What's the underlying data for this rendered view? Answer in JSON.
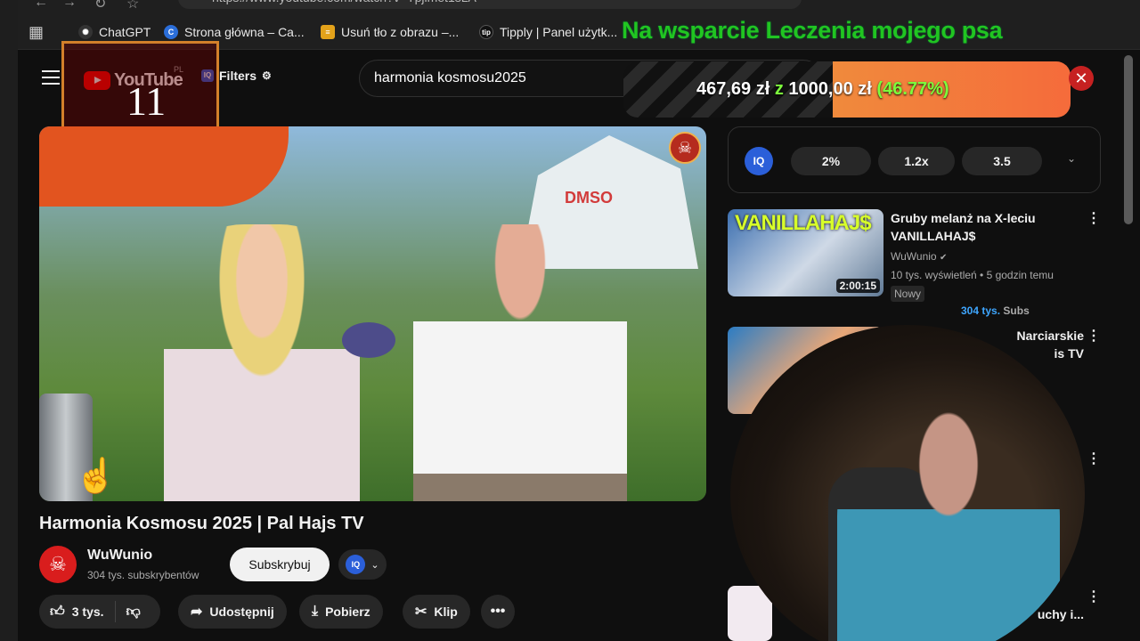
{
  "browser": {
    "url": "https://www.youtube.com/watch?v=Tpjlmet1sLA",
    "bookmarks": [
      {
        "label": "ChatGPT",
        "color": "#1a1a1a"
      },
      {
        "label": "Strona główna – Ca...",
        "color": "#2b6ed9"
      },
      {
        "label": "Usuń tło z obrazu –...",
        "color": "#e3a21a"
      },
      {
        "label": "Tipply | Panel użytk...",
        "color": "#111111"
      }
    ]
  },
  "overlay": {
    "title": "Na wsparcie Leczenia mojego psa",
    "counter": "11",
    "donation_amount": "467,69 zł",
    "donation_sep": "z",
    "donation_goal": "1000,00 zł",
    "donation_percent": "(46.77%)",
    "donation_fraction": 0.4677
  },
  "masthead": {
    "logo": "YouTube",
    "region": "PL",
    "filters_label": "Filters",
    "search_value": "harmonia kosmosu2025"
  },
  "video": {
    "tent_text": "DMSO",
    "title": "Harmonia Kosmosu 2025 | Pal Hajs TV",
    "channel": "WuWunio",
    "subscribers": "304 tys. subskrybentów",
    "subscribe_label": "Subskrybuj",
    "actions": {
      "likes": "3 tys.",
      "share": "Udostępnij",
      "download": "Pobierz",
      "clip": "Klip"
    }
  },
  "iq_panel": {
    "logo": "IQ",
    "chips": [
      "2%",
      "1.2x",
      "3.5"
    ]
  },
  "recommendations": [
    {
      "thumb_text": "VANILLAHAJ$",
      "duration": "2:00:15",
      "title": "Gruby melanż na X-leciu VANILLAHAJ$",
      "channel": "WuWunio",
      "meta": "10 tys. wyświetleń • 5 godzin temu",
      "badge": "Nowy",
      "subs_num": "304",
      "subs_unit": "tys.",
      "subs_label": "Subs"
    },
    {
      "title": "Narciarskie",
      "title2": "is TV"
    },
    {
      "title": "uchy i..."
    }
  ],
  "colors": {
    "bg": "#0f0f0f",
    "overlay_green": "#21c521",
    "donation_fill": "#f08a3c",
    "yt_red": "#ff0000",
    "iq_blue": "#2b5fd9"
  }
}
